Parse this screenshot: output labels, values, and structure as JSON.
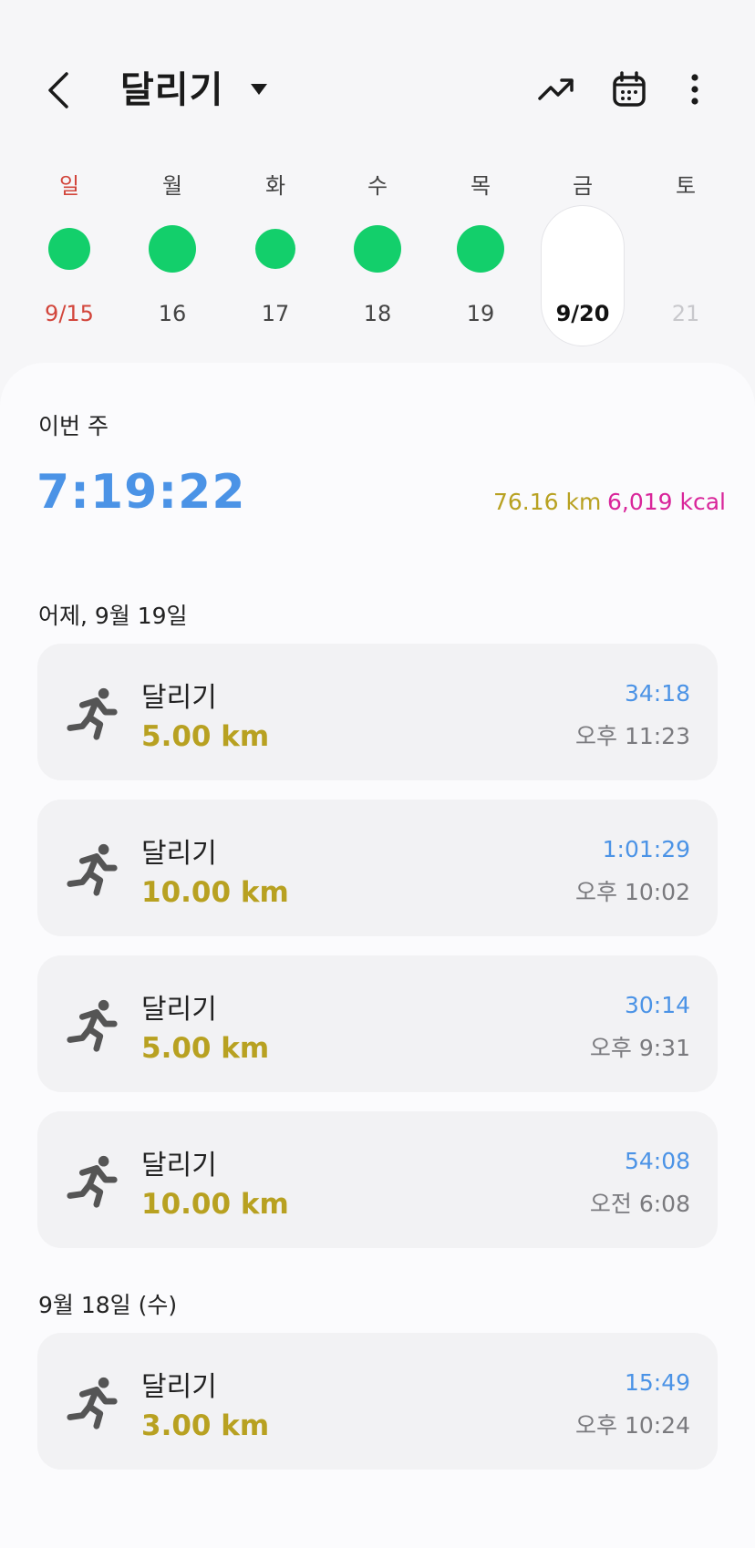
{
  "header": {
    "title": "달리기",
    "back_icon": "chevron-left-icon",
    "dropdown_icon": "caret-down-icon",
    "actions": [
      "trend-icon",
      "calendar-icon",
      "more-vert-icon"
    ]
  },
  "week_strip": {
    "days": [
      {
        "dow": "일",
        "date": "9/15",
        "has_run": true
      },
      {
        "dow": "월",
        "date": "16",
        "has_run": true
      },
      {
        "dow": "화",
        "date": "17",
        "has_run": true
      },
      {
        "dow": "수",
        "date": "18",
        "has_run": true
      },
      {
        "dow": "목",
        "date": "19",
        "has_run": true
      },
      {
        "dow": "금",
        "date": "9/20",
        "has_run": false,
        "selected": true
      },
      {
        "dow": "토",
        "date": "21",
        "has_run": false
      }
    ]
  },
  "summary": {
    "label": "이번 주",
    "total_time": "7:19:22",
    "distance": "76.16  km",
    "calories": "6,019  kcal"
  },
  "sections": [
    {
      "label": "어제, 9월 19일",
      "items": [
        {
          "title": "달리기",
          "distance": "5.00 km",
          "duration": "34:18",
          "time": "오후 11:23"
        },
        {
          "title": "달리기",
          "distance": "10.00 km",
          "duration": "1:01:29",
          "time": "오후 10:02"
        },
        {
          "title": "달리기",
          "distance": "5.00 km",
          "duration": "30:14",
          "time": "오후 9:31"
        },
        {
          "title": "달리기",
          "distance": "10.00 km",
          "duration": "54:08",
          "time": "오전 6:08"
        }
      ]
    },
    {
      "label": "9월 18일 (수)",
      "items": [
        {
          "title": "달리기",
          "distance": "3.00 km",
          "duration": "15:49",
          "time": "오후 10:24"
        }
      ]
    }
  ],
  "colors": {
    "accent_blue": "#4b93e6",
    "distance_gold": "#b8a121",
    "calorie_magenta": "#d9259a",
    "activity_green": "#13cf6b",
    "sunday_red": "#d2453b"
  }
}
